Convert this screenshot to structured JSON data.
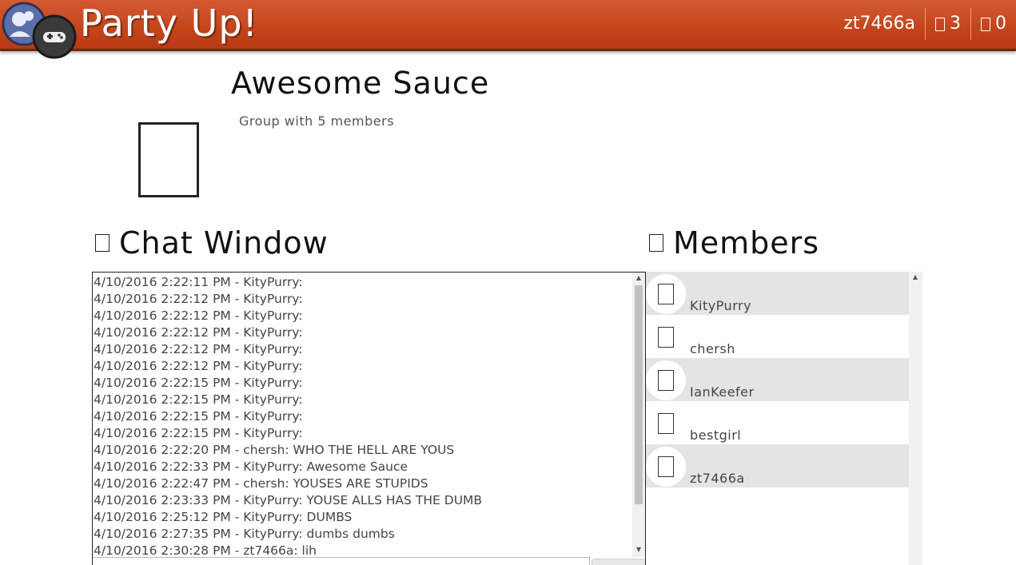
{
  "header": {
    "brand": "Party Up!",
    "username": "zt7466a",
    "notifications_count": "3",
    "messages_count": "0",
    "colors": {
      "bar": "#c4441b",
      "text": "#ffffff"
    }
  },
  "group": {
    "title": "Awesome Sauce",
    "subtitle": "Group with 5 members"
  },
  "chat": {
    "heading": "Chat Window",
    "lines": [
      "4/10/2016 2:22:11 PM - KityPurry:",
      "4/10/2016 2:22:12 PM - KityPurry:",
      "4/10/2016 2:22:12 PM - KityPurry:",
      "4/10/2016 2:22:12 PM - KityPurry:",
      "4/10/2016 2:22:12 PM - KityPurry:",
      "4/10/2016 2:22:12 PM - KityPurry:",
      "4/10/2016 2:22:15 PM - KityPurry:",
      "4/10/2016 2:22:15 PM - KityPurry:",
      "4/10/2016 2:22:15 PM - KityPurry:",
      "4/10/2016 2:22:15 PM - KityPurry:",
      "4/10/2016 2:22:20 PM - chersh: WHO THE HELL ARE YOUS",
      "4/10/2016 2:22:33 PM - KityPurry: Awesome Sauce",
      "4/10/2016 2:22:47 PM - chersh: YOUSES ARE STUPIDS",
      "4/10/2016 2:23:33 PM - KityPurry: YOUSE ALLS HAS THE DUMB",
      "4/10/2016 2:25:12 PM - KityPurry: DUMBS",
      "4/10/2016 2:27:35 PM - KityPurry: dumbs dumbs",
      "4/10/2016 2:30:28 PM - zt7466a: lih"
    ]
  },
  "members": {
    "heading": "Members",
    "items": [
      {
        "name": "KityPurry",
        "shaded": true
      },
      {
        "name": "chersh",
        "shaded": false
      },
      {
        "name": "IanKeefer",
        "shaded": true
      },
      {
        "name": "bestgirl",
        "shaded": false
      },
      {
        "name": "zt7466a",
        "shaded": true
      }
    ]
  }
}
